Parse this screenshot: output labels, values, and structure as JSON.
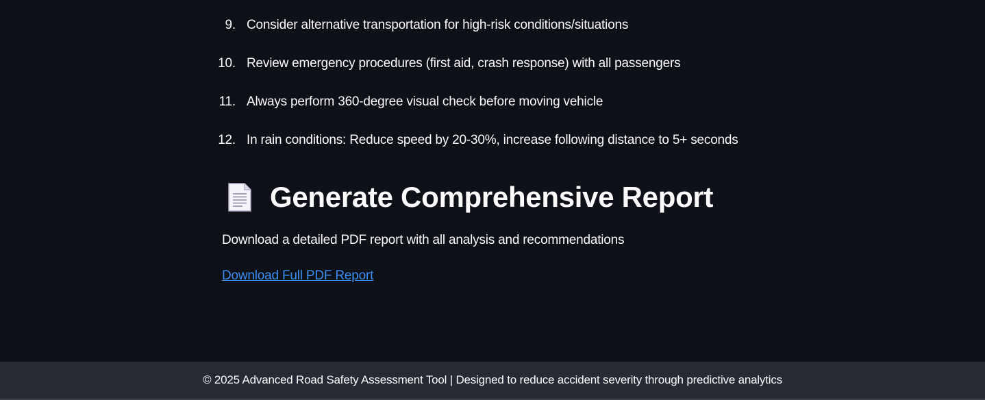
{
  "recommendations": [
    {
      "number": "9.",
      "text": "Consider alternative transportation for high-risk conditions/situations"
    },
    {
      "number": "10.",
      "text": "Review emergency procedures (first aid, crash response) with all passengers"
    },
    {
      "number": "11.",
      "text": "Always perform 360-degree visual check before moving vehicle"
    },
    {
      "number": "12.",
      "text": "In rain conditions: Reduce speed by 20-30%, increase following distance to 5+ seconds"
    }
  ],
  "report": {
    "icon": "document-icon",
    "title": "Generate Comprehensive Report",
    "description": "Download a detailed PDF report with all analysis and recommendations",
    "download_link": "Download Full PDF Report"
  },
  "footer": {
    "text": "© 2025 Advanced Road Safety Assessment Tool | Designed to reduce accident severity through predictive analytics"
  },
  "colors": {
    "background": "#0e1117",
    "footer_background": "#262a35",
    "link": "#3d8ef0",
    "text": "#fafafa"
  }
}
